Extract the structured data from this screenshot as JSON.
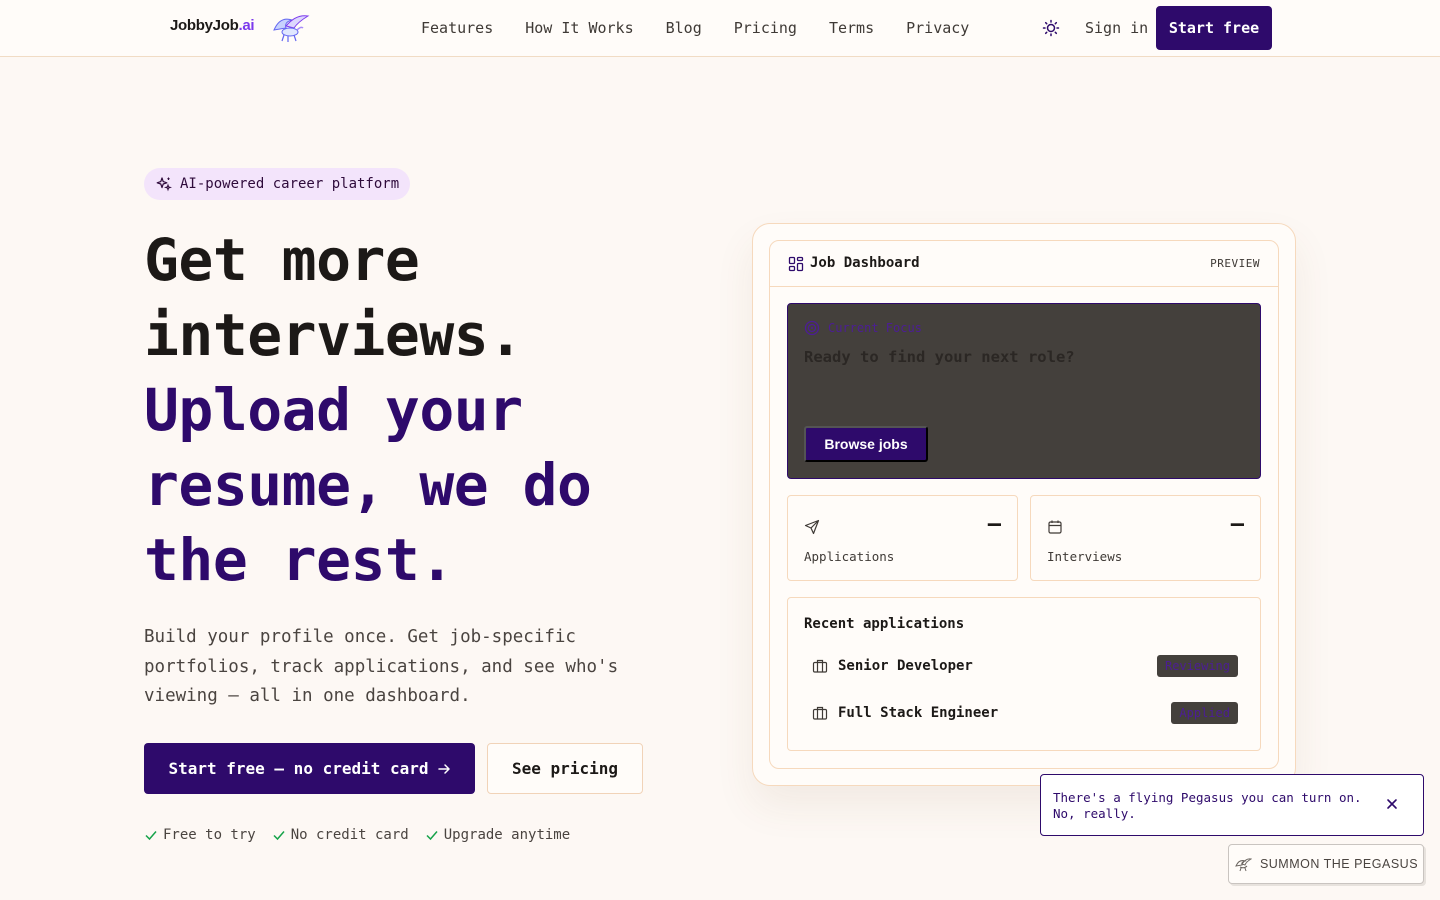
{
  "nav": {
    "logo_main": "JobbyJob",
    "logo_suffix": ".ai",
    "links": [
      "Features",
      "How It Works",
      "Blog",
      "Pricing",
      "Terms",
      "Privacy"
    ],
    "signin": "Sign in",
    "start_free": "Start free",
    "theme_icon": "sun-icon"
  },
  "hero": {
    "badge": "AI-powered career platform",
    "headline_line1": "Get more interviews.",
    "headline_line2": "Upload your resume, we do the rest.",
    "subtitle": "Build your profile once. Get job-specific portfolios, track applications, and see who's viewing — all in one dashboard.",
    "cta_primary": "Start free — no credit card",
    "cta_secondary": "See pricing",
    "perks": [
      "Free to try",
      "No credit card",
      "Upgrade anytime"
    ]
  },
  "dashboard": {
    "title": "Job Dashboard",
    "preview_label": "PREVIEW",
    "focus": {
      "label": "Current Focus",
      "text": "Ready to find your next role?",
      "button": "Browse jobs"
    },
    "stats": [
      {
        "label": "Applications",
        "value": "–",
        "icon": "send-icon"
      },
      {
        "label": "Interviews",
        "value": "–",
        "icon": "calendar-icon"
      }
    ],
    "recent": {
      "title": "Recent applications",
      "items": [
        {
          "job": "Senior Developer",
          "status": "Reviewing"
        },
        {
          "job": "Full Stack Engineer",
          "status": "Applied"
        }
      ]
    }
  },
  "toast": {
    "text": "There's a flying Pegasus you can turn on. No, really."
  },
  "summon": {
    "label": "SUMMON THE PEGASUS"
  },
  "colors": {
    "brand": "#2e0a6b",
    "accent": "#7c3aed",
    "background": "#fdf8f4",
    "border": "#f6d9bd"
  }
}
